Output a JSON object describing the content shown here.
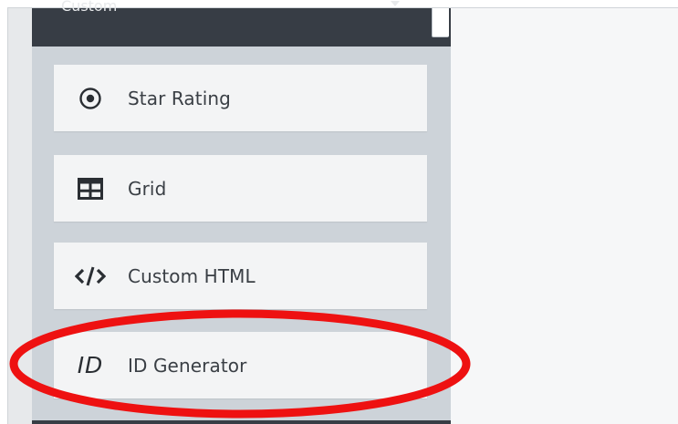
{
  "panel": {
    "header_label": "Custom"
  },
  "fields": [
    {
      "label": "Star Rating",
      "icon": "radio-dot-icon"
    },
    {
      "label": "Grid",
      "icon": "grid-table-icon"
    },
    {
      "label": "Custom HTML",
      "icon": "code-icon"
    },
    {
      "label": "ID Generator",
      "icon": "id-text-icon",
      "icon_text": "ID"
    }
  ],
  "annotation": {
    "color": "#ee1111",
    "target": "ID Generator"
  },
  "colors": {
    "panel_header": "#373d45",
    "panel_bg": "#cdd3d9",
    "card_bg": "#f3f4f5",
    "text": "#3a3f45"
  }
}
